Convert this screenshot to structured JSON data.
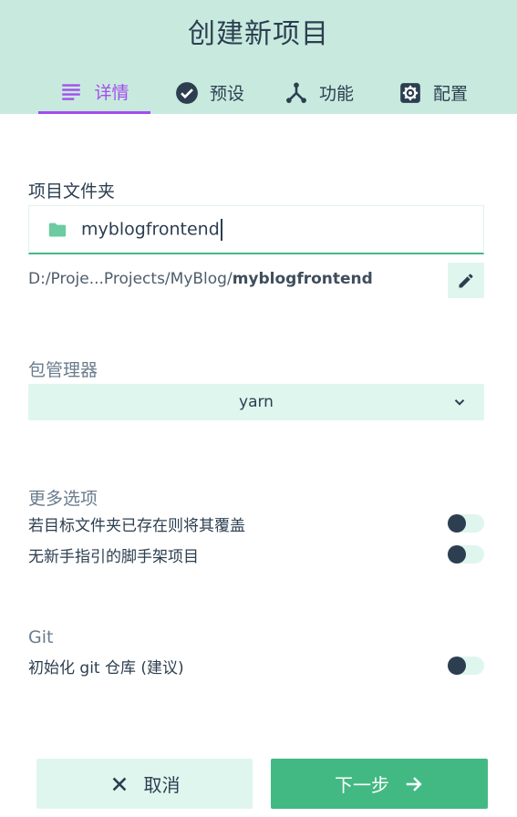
{
  "header": {
    "title": "创建新项目"
  },
  "tabs": [
    {
      "label": "详情",
      "icon": "list-icon",
      "active": true
    },
    {
      "label": "预设",
      "icon": "check-circle-icon",
      "active": false
    },
    {
      "label": "功能",
      "icon": "call-split-icon",
      "active": false
    },
    {
      "label": "配置",
      "icon": "gear-icon",
      "active": false
    }
  ],
  "folder": {
    "label": "项目文件夹",
    "value": "myblogfrontend",
    "path_prefix": "D:/Proje...Projects/MyBlog/",
    "path_name": "myblogfrontend"
  },
  "package_manager": {
    "label": "包管理器",
    "selected": "yarn"
  },
  "more_options": {
    "label": "更多选项",
    "items": [
      {
        "label": "若目标文件夹已存在则将其覆盖",
        "enabled": false
      },
      {
        "label": "无新手指引的脚手架项目",
        "enabled": false
      }
    ]
  },
  "git": {
    "label": "Git",
    "items": [
      {
        "label": "初始化 git 仓库 (建议)",
        "enabled": false
      }
    ]
  },
  "actions": {
    "cancel_label": "取消",
    "next_label": "下一步"
  },
  "colors": {
    "header_bg": "#c8eade",
    "accent_purple": "#a44cf0",
    "primary_green": "#42b983",
    "light_green": "#dff6ee",
    "text_dark": "#2c3e50"
  }
}
